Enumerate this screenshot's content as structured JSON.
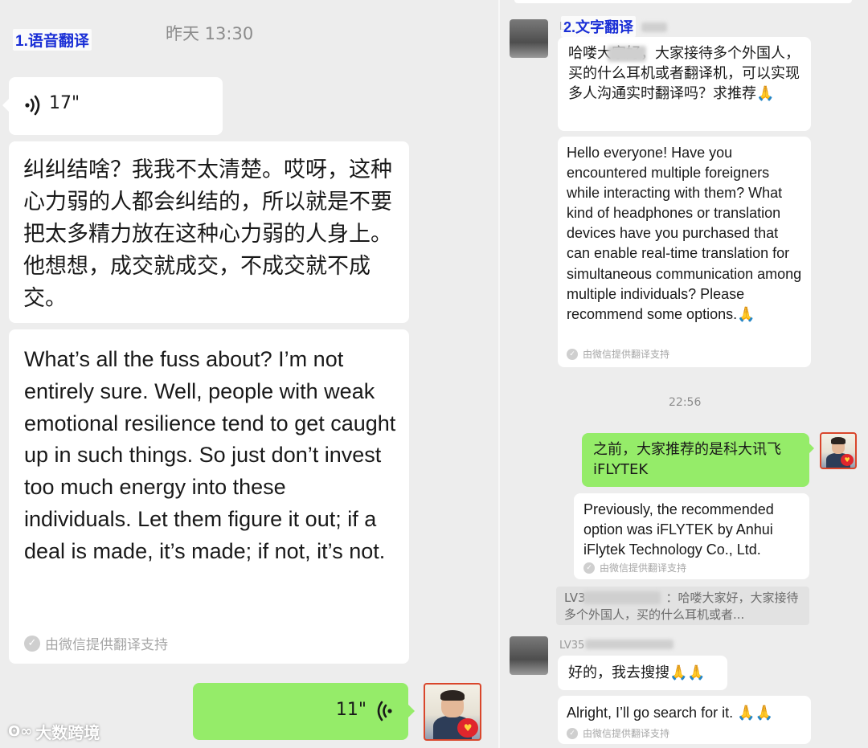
{
  "left": {
    "section_label": "1.语音翻译",
    "timestamp": "昨天 13:30",
    "incoming_voice": {
      "duration": "17\""
    },
    "transcript_zh": "纠纠结啥？我我不太清楚。哎呀，这种心力弱的人都会纠结的，所以就是不要把太多精力放在这种心力弱的人身上。他想想，成交就成交，不成交就不成交。",
    "translation_en": "What’s all the fuss about? I’m not entirely sure. Well, people with weak emotional resilience tend to get caught up in such things. So just don’t invest too much energy into these individuals. Let them figure it out; if a deal is made, it’s made; if not, it’s not.",
    "translation_note": "由微信提供翻译支持",
    "outgoing_voice": {
      "duration": "11\""
    },
    "watermark": "大数跨境"
  },
  "right": {
    "section_label": "2.文字翻译",
    "msg1": {
      "sender_prefix": "LV",
      "text_zh": "哈喽大家好，大家接待多个外国人，买的什么耳机或者翻译机，可以实现多人沟通实时翻译吗？求推荐🙏",
      "translation_en": "Hello everyone! Have you encountered multiple foreigners while interacting with them? What kind of headphones or translation devices have you purchased that can enable real-time translation for simultaneous communication among multiple individuals? Please recommend some options.🙏",
      "translation_note": "由微信提供翻译支持"
    },
    "timestamp": "22:56",
    "msg2": {
      "text_zh": "之前，大家推荐的是科大讯飞iFLYTEK",
      "translation_en": "Previously, the recommended option was iFLYTEK by Anhui iFlytek Technology Co., Ltd.",
      "translation_note": "由微信提供翻译支持",
      "quote_prefix": "LV3",
      "quote_text": "：哈喽大家好，大家接待多个外国人，买的什么耳机或者..."
    },
    "msg3": {
      "sender_prefix": "LV35",
      "text_zh": "好的，我去搜搜🙏🙏",
      "translation_en": "Alright, I’ll go search for it. 🙏🙏",
      "translation_note": "由微信提供翻译支持"
    }
  },
  "colors": {
    "background": "#ededed",
    "bubble_white": "#ffffff",
    "bubble_green": "#95ec69",
    "label_blue": "#1a2fd6",
    "meta_gray": "#a7a7a7"
  }
}
